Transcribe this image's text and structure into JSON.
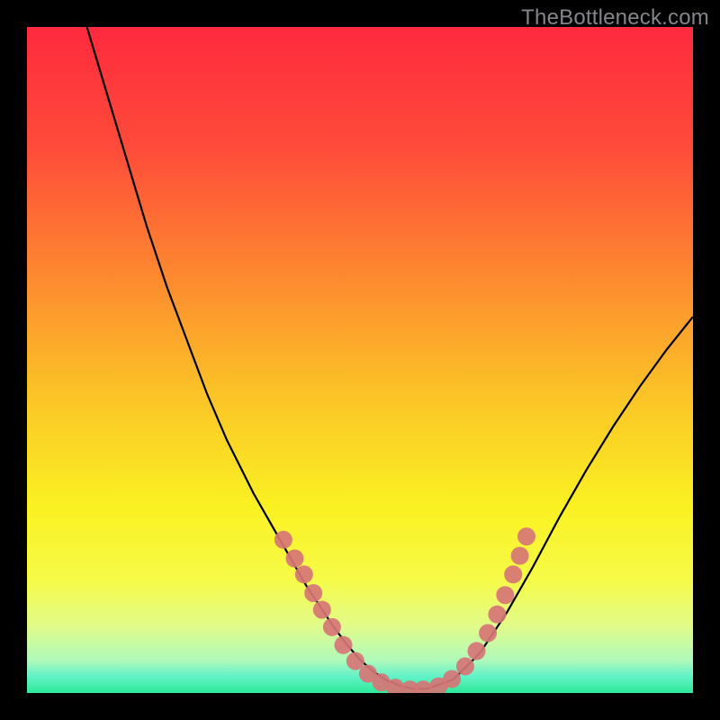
{
  "watermark": "TheBottleneck.com",
  "colors": {
    "frame": "#000000",
    "gradient_stops": [
      {
        "offset": 0.0,
        "color": "#fe2a3e"
      },
      {
        "offset": 0.18,
        "color": "#fe4b3a"
      },
      {
        "offset": 0.36,
        "color": "#fd8430"
      },
      {
        "offset": 0.55,
        "color": "#fbc327"
      },
      {
        "offset": 0.72,
        "color": "#faf122"
      },
      {
        "offset": 0.83,
        "color": "#f6fb48"
      },
      {
        "offset": 0.9,
        "color": "#e1fb8a"
      },
      {
        "offset": 0.95,
        "color": "#b0f9ba"
      },
      {
        "offset": 0.975,
        "color": "#63f2c8"
      },
      {
        "offset": 1.0,
        "color": "#2de999"
      }
    ],
    "curve_stroke": "#000000",
    "marker_fill": "#d67576",
    "marker_stroke": "#d67576"
  },
  "chart_data": {
    "type": "line",
    "title": "",
    "xlabel": "",
    "ylabel": "",
    "xlim": [
      0,
      100
    ],
    "ylim": [
      0,
      100
    ],
    "series": [
      {
        "name": "curve",
        "x": [
          9,
          12,
          15,
          18,
          21,
          24,
          27,
          30,
          32,
          34,
          36,
          38,
          40,
          42,
          44,
          46,
          48,
          50,
          52,
          54,
          56,
          58,
          60,
          64,
          68,
          72,
          76,
          80,
          84,
          88,
          92,
          96,
          100
        ],
        "y": [
          100,
          90,
          80,
          70,
          61,
          53,
          45,
          38,
          34,
          30,
          26.5,
          23,
          19.5,
          16,
          13,
          10,
          7.3,
          5.0,
          3.2,
          1.9,
          1.1,
          0.6,
          0.6,
          2.0,
          6.0,
          12.0,
          19.0,
          26.5,
          33.5,
          40.0,
          46.0,
          51.5,
          56.5
        ]
      }
    ],
    "markers": [
      {
        "x": 38.5,
        "y": 23.0
      },
      {
        "x": 40.2,
        "y": 20.2
      },
      {
        "x": 41.6,
        "y": 17.8
      },
      {
        "x": 43.0,
        "y": 15.0
      },
      {
        "x": 44.3,
        "y": 12.5
      },
      {
        "x": 45.8,
        "y": 9.9
      },
      {
        "x": 47.5,
        "y": 7.2
      },
      {
        "x": 49.3,
        "y": 4.8
      },
      {
        "x": 51.2,
        "y": 2.9
      },
      {
        "x": 53.2,
        "y": 1.6
      },
      {
        "x": 55.3,
        "y": 0.8
      },
      {
        "x": 57.5,
        "y": 0.5
      },
      {
        "x": 59.5,
        "y": 0.5
      },
      {
        "x": 61.8,
        "y": 1.0
      },
      {
        "x": 63.8,
        "y": 2.1
      },
      {
        "x": 65.8,
        "y": 4.0
      },
      {
        "x": 67.5,
        "y": 6.3
      },
      {
        "x": 69.2,
        "y": 9.0
      },
      {
        "x": 70.6,
        "y": 11.8
      },
      {
        "x": 71.8,
        "y": 14.7
      },
      {
        "x": 73.0,
        "y": 17.8
      },
      {
        "x": 74.0,
        "y": 20.6
      },
      {
        "x": 75.0,
        "y": 23.5
      }
    ],
    "marker_radius_px": 10
  }
}
